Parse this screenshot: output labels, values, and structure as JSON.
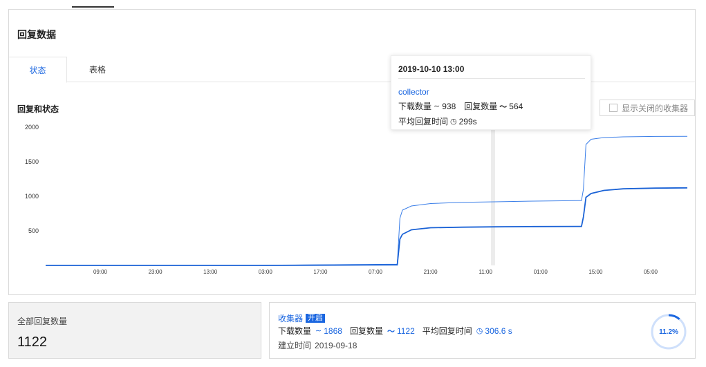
{
  "panel": {
    "title": "回复数据"
  },
  "tabs": [
    {
      "label": "状态",
      "active": true
    },
    {
      "label": "表格",
      "active": false
    }
  ],
  "chart_title": "回复和状态",
  "toggle_label": "显示关闭的收集器",
  "chart_data": {
    "type": "line",
    "yticks": [
      "2000",
      "1500",
      "1000",
      "500"
    ],
    "xticks": [
      "09:00",
      "23:00",
      "13:00",
      "03:00",
      "17:00",
      "07:00",
      "21:00",
      "11:00",
      "01:00",
      "15:00",
      "05:00"
    ],
    "ylim": [
      0,
      2000
    ],
    "series": [
      {
        "name": "下载数量",
        "color": "#3a7ee8",
        "points": [
          [
            0,
            0
          ],
          [
            0.33,
            0
          ],
          [
            0.42,
            8
          ],
          [
            0.5,
            14
          ],
          [
            0.548,
            17
          ],
          [
            0.552,
            680
          ],
          [
            0.556,
            800
          ],
          [
            0.57,
            860
          ],
          [
            0.6,
            895
          ],
          [
            0.65,
            912
          ],
          [
            0.7,
            920
          ],
          [
            0.76,
            930
          ],
          [
            0.83,
            938
          ],
          [
            0.835,
            938
          ],
          [
            0.838,
            1100
          ],
          [
            0.842,
            1750
          ],
          [
            0.85,
            1825
          ],
          [
            0.87,
            1850
          ],
          [
            0.9,
            1860
          ],
          [
            0.95,
            1866
          ],
          [
            1,
            1868
          ]
        ]
      },
      {
        "name": "回复数量",
        "color": "#1a62d6",
        "points": [
          [
            0,
            0
          ],
          [
            0.33,
            0
          ],
          [
            0.42,
            3
          ],
          [
            0.5,
            6
          ],
          [
            0.548,
            8
          ],
          [
            0.552,
            380
          ],
          [
            0.556,
            450
          ],
          [
            0.57,
            515
          ],
          [
            0.6,
            545
          ],
          [
            0.65,
            553
          ],
          [
            0.7,
            558
          ],
          [
            0.76,
            562
          ],
          [
            0.83,
            564
          ],
          [
            0.835,
            564
          ],
          [
            0.838,
            700
          ],
          [
            0.842,
            985
          ],
          [
            0.85,
            1040
          ],
          [
            0.87,
            1085
          ],
          [
            0.9,
            1108
          ],
          [
            0.95,
            1118
          ],
          [
            1,
            1122
          ]
        ]
      }
    ]
  },
  "tooltip": {
    "date": "2019-10-10 13:00",
    "name": "collector",
    "download_label": "下载数量",
    "download_value": "938",
    "reply_label": "回复数量",
    "reply_value": "564",
    "avg_label": "平均回复时间",
    "avg_value": "299s"
  },
  "total_card": {
    "label": "全部回复数量",
    "value": "1122"
  },
  "collector_card": {
    "name": "收集器",
    "status": "开启",
    "download_label": "下载数量",
    "download_value": "1868",
    "reply_label": "回复数量",
    "reply_value": "1122",
    "avg_label": "平均回复时间",
    "avg_value": "306.6 s",
    "created_label": "建立时间",
    "created_value": "2019-09-18",
    "percent_text": "11.2%",
    "percent": 0.112
  },
  "colors": {
    "accent": "#1a66e0",
    "line_light": "#3a7ee8",
    "line_dark": "#1a62d6"
  }
}
